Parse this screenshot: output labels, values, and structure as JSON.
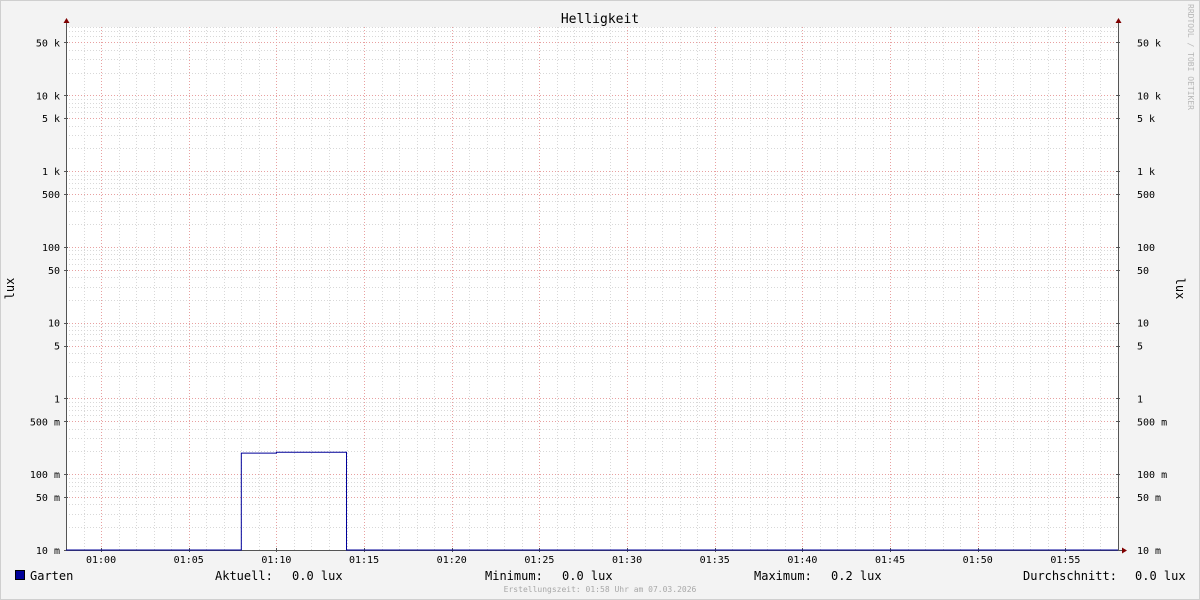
{
  "watermark": "RRDTOOL / TOBI OETIKER",
  "legend": {
    "series_name": "Garten",
    "current_label": "Aktuell:",
    "current_value": "0.0 lux",
    "min_label": "Minimum:",
    "min_value": "0.0 lux",
    "max_label": "Maximum:",
    "max_value": "0.2 lux",
    "avg_label": "Durchschnitt:",
    "avg_value": "0.0 lux"
  },
  "footer": "Erstellungszeit: 01:58 Uhr am 07.03.2026",
  "colors": {
    "background": "#f3f3f3",
    "plot_background": "#ffffff",
    "series": "#000099",
    "major_grid": "#e8a0a0",
    "minor_grid": "#d8d8d8",
    "axis": "#7f0000"
  },
  "chart_data": {
    "type": "line",
    "title": "Helligkeit",
    "ylabel": "lux",
    "ylabel_right": "lux",
    "y_scale": "log",
    "ylim": [
      0.01,
      80000
    ],
    "xlim_minutes": [
      -2,
      58
    ],
    "x_ticks": [
      {
        "t": 0,
        "label": "01:00"
      },
      {
        "t": 5,
        "label": "01:05"
      },
      {
        "t": 10,
        "label": "01:10"
      },
      {
        "t": 15,
        "label": "01:15"
      },
      {
        "t": 20,
        "label": "01:20"
      },
      {
        "t": 25,
        "label": "01:25"
      },
      {
        "t": 30,
        "label": "01:30"
      },
      {
        "t": 35,
        "label": "01:35"
      },
      {
        "t": 40,
        "label": "01:40"
      },
      {
        "t": 45,
        "label": "01:45"
      },
      {
        "t": 50,
        "label": "01:50"
      },
      {
        "t": 55,
        "label": "01:55"
      }
    ],
    "y_ticks": [
      {
        "v": 0.01,
        "label": "10 m"
      },
      {
        "v": 0.05,
        "label": "50 m"
      },
      {
        "v": 0.1,
        "label": "100 m"
      },
      {
        "v": 0.5,
        "label": "500 m"
      },
      {
        "v": 1,
        "label": "1"
      },
      {
        "v": 5,
        "label": "5"
      },
      {
        "v": 10,
        "label": "10"
      },
      {
        "v": 50,
        "label": "50"
      },
      {
        "v": 100,
        "label": "100"
      },
      {
        "v": 500,
        "label": "500"
      },
      {
        "v": 1000,
        "label": "1 k"
      },
      {
        "v": 5000,
        "label": "5 k"
      },
      {
        "v": 10000,
        "label": "10 k"
      },
      {
        "v": 50000,
        "label": "50 k"
      }
    ],
    "series": [
      {
        "name": "Garten",
        "points": [
          {
            "t": -2,
            "v": 0.01
          },
          {
            "t": 8,
            "v": 0.01
          },
          {
            "t": 8,
            "v": 0.19
          },
          {
            "t": 10,
            "v": 0.19
          },
          {
            "t": 10,
            "v": 0.195
          },
          {
            "t": 14,
            "v": 0.195
          },
          {
            "t": 14,
            "v": 0.01
          },
          {
            "t": 58,
            "v": 0.01
          }
        ]
      }
    ],
    "grid": true,
    "legend_position": "bottom"
  }
}
